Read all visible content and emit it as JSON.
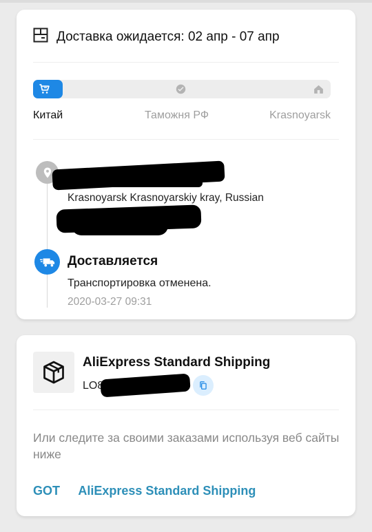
{
  "delivery": {
    "expected_text": "Доставка ожидается: 02 апр - 07 апр"
  },
  "progress": {
    "stages": [
      "Китай",
      "Таможня РФ",
      "Krasnoyarsk"
    ],
    "current_stage_index": 0,
    "active_color": "#1e88e5",
    "inactive_label_color": "#9e9e9e"
  },
  "address": {
    "line": "Krasnoyarsk Krasnoyarskiy kray, Russian"
  },
  "status": {
    "title": "Доставляется",
    "description": "Транспортировка отменена.",
    "timestamp": "2020-03-27 09:31"
  },
  "shipping": {
    "carrier": "AliExpress Standard Shipping",
    "tracking_prefix": "LO85"
  },
  "hint": "Или следите за своими заказами используя веб сайты ниже",
  "links": [
    "GOT",
    "AliExpress Standard Shipping"
  ],
  "icons": {
    "delivery": "package-calendar-icon",
    "stage1": "cart-icon",
    "stage2": "customs-icon",
    "stage3": "home-icon",
    "location": "location-pin-icon",
    "status": "truck-icon",
    "carrier": "box-icon",
    "copy": "copy-icon"
  }
}
